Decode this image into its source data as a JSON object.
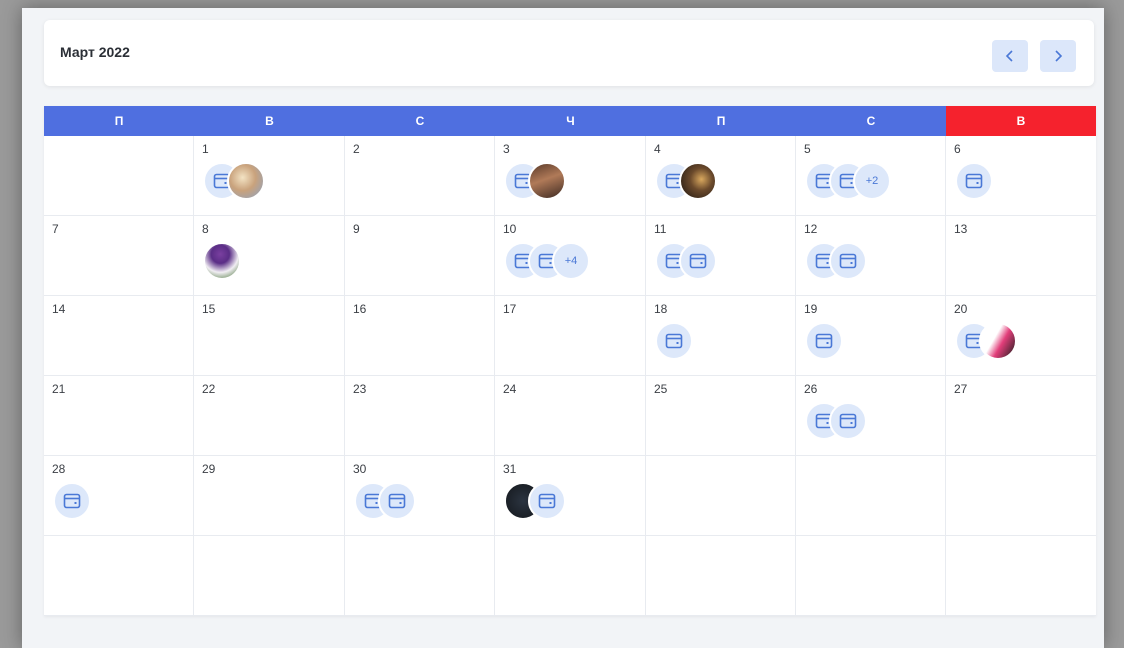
{
  "header": {
    "title": "Март 2022",
    "prev_icon": "chevron-left-icon",
    "next_icon": "chevron-right-icon"
  },
  "colors": {
    "weekday_bg": "#4f6fe0",
    "weekend_bg": "#f5222d",
    "event_bg": "#dde8fa",
    "accent": "#4a78d6"
  },
  "weekdays": [
    {
      "label": "П",
      "weekend": false
    },
    {
      "label": "В",
      "weekend": false
    },
    {
      "label": "С",
      "weekend": false
    },
    {
      "label": "Ч",
      "weekend": false
    },
    {
      "label": "П",
      "weekend": false
    },
    {
      "label": "С",
      "weekend": false
    },
    {
      "label": "В",
      "weekend": true
    }
  ],
  "weeks": [
    [
      {
        "day": "",
        "events": []
      },
      {
        "day": "1",
        "events": [
          {
            "type": "calendar"
          },
          {
            "type": "photo",
            "photo": "children-photo"
          }
        ]
      },
      {
        "day": "2",
        "events": []
      },
      {
        "day": "3",
        "events": [
          {
            "type": "calendar"
          },
          {
            "type": "photo",
            "photo": "cake-photo"
          }
        ]
      },
      {
        "day": "4",
        "events": [
          {
            "type": "calendar"
          },
          {
            "type": "photo",
            "photo": "dogs-photo"
          }
        ]
      },
      {
        "day": "5",
        "events": [
          {
            "type": "calendar"
          },
          {
            "type": "calendar"
          },
          {
            "type": "more",
            "label": "+2"
          }
        ]
      },
      {
        "day": "6",
        "events": [
          {
            "type": "calendar"
          }
        ]
      }
    ],
    [
      {
        "day": "7",
        "events": []
      },
      {
        "day": "8",
        "events": [
          {
            "type": "photo",
            "photo": "tulips-photo"
          }
        ]
      },
      {
        "day": "9",
        "events": []
      },
      {
        "day": "10",
        "events": [
          {
            "type": "calendar"
          },
          {
            "type": "calendar"
          },
          {
            "type": "more",
            "label": "+4"
          }
        ]
      },
      {
        "day": "11",
        "events": [
          {
            "type": "calendar"
          },
          {
            "type": "calendar"
          }
        ]
      },
      {
        "day": "12",
        "events": [
          {
            "type": "calendar"
          },
          {
            "type": "calendar"
          }
        ]
      },
      {
        "day": "13",
        "events": []
      }
    ],
    [
      {
        "day": "14",
        "events": []
      },
      {
        "day": "15",
        "events": []
      },
      {
        "day": "16",
        "events": []
      },
      {
        "day": "17",
        "events": []
      },
      {
        "day": "18",
        "events": [
          {
            "type": "calendar"
          }
        ]
      },
      {
        "day": "19",
        "events": [
          {
            "type": "calendar"
          }
        ]
      },
      {
        "day": "20",
        "events": [
          {
            "type": "calendar"
          },
          {
            "type": "photo",
            "photo": "poster-photo"
          }
        ]
      }
    ],
    [
      {
        "day": "21",
        "events": []
      },
      {
        "day": "22",
        "events": []
      },
      {
        "day": "23",
        "events": []
      },
      {
        "day": "24",
        "events": []
      },
      {
        "day": "25",
        "events": []
      },
      {
        "day": "26",
        "events": [
          {
            "type": "calendar"
          },
          {
            "type": "calendar"
          }
        ]
      },
      {
        "day": "27",
        "events": []
      }
    ],
    [
      {
        "day": "28",
        "events": [
          {
            "type": "calendar"
          }
        ]
      },
      {
        "day": "29",
        "events": []
      },
      {
        "day": "30",
        "events": [
          {
            "type": "calendar"
          },
          {
            "type": "calendar"
          }
        ]
      },
      {
        "day": "31",
        "events": [
          {
            "type": "photo",
            "photo": "dark-screen-photo"
          },
          {
            "type": "calendar"
          }
        ]
      },
      {
        "day": "",
        "events": []
      },
      {
        "day": "",
        "events": []
      },
      {
        "day": "",
        "events": []
      }
    ],
    [
      {
        "day": "",
        "events": []
      },
      {
        "day": "",
        "events": []
      },
      {
        "day": "",
        "events": []
      },
      {
        "day": "",
        "events": []
      },
      {
        "day": "",
        "events": []
      },
      {
        "day": "",
        "events": []
      },
      {
        "day": "",
        "events": []
      }
    ]
  ]
}
